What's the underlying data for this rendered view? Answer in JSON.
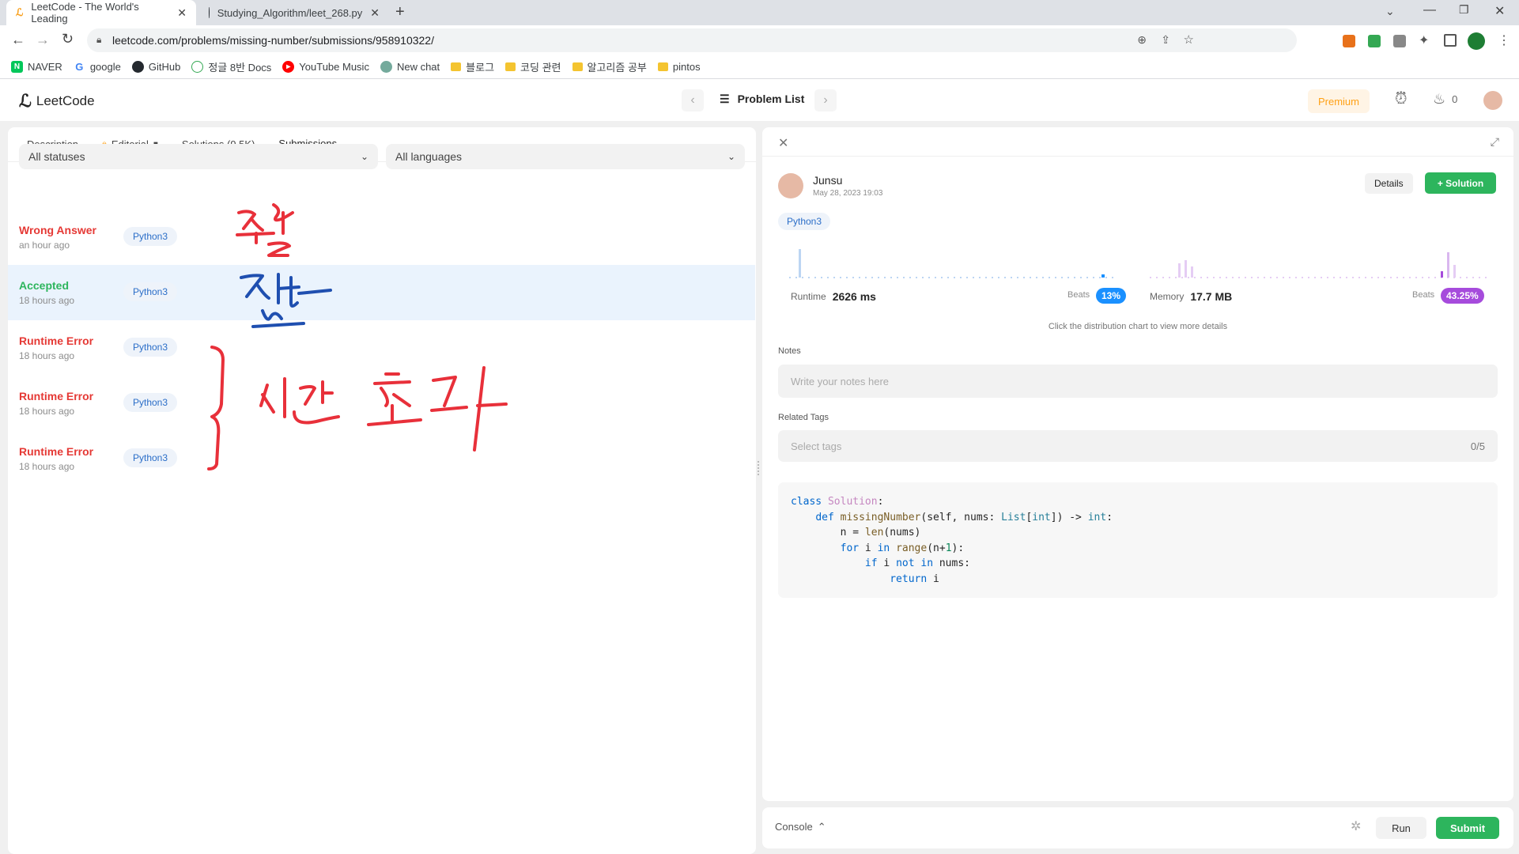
{
  "browser": {
    "tabs": [
      {
        "title": "LeetCode - The World's Leading"
      },
      {
        "title": "Studying_Algorithm/leet_268.py"
      }
    ],
    "new_tab": "+",
    "url": "leetcode.com/problems/missing-number/submissions/958910322/",
    "bookmarks": [
      "NAVER",
      "google",
      "GitHub",
      "정글 8반 Docs",
      "YouTube Music",
      "New chat",
      "블로그",
      "코딩 관련",
      "알고리즘 공부",
      "pintos"
    ]
  },
  "nav": {
    "logo": "LeetCode",
    "problem_list": "Problem List",
    "premium": "Premium",
    "streak": "0"
  },
  "left": {
    "tabs": {
      "description": "Description",
      "editorial": "Editorial",
      "solutions": "Solutions (9.5K)",
      "submissions": "Submissions"
    },
    "filters": {
      "status": "All statuses",
      "language": "All languages"
    },
    "submissions": [
      {
        "status": "Wrong Answer",
        "time": "an hour ago",
        "lang": "Python3"
      },
      {
        "status": "Accepted",
        "time": "18 hours ago",
        "lang": "Python3"
      },
      {
        "status": "Runtime Error",
        "time": "18 hours ago",
        "lang": "Python3"
      },
      {
        "status": "Runtime Error",
        "time": "18 hours ago",
        "lang": "Python3"
      },
      {
        "status": "Runtime Error",
        "time": "18 hours ago",
        "lang": "Python3"
      }
    ]
  },
  "right": {
    "user": "Junsu",
    "date": "May 28, 2023 19:03",
    "details": "Details",
    "solution": "+ Solution",
    "lang": "Python3",
    "runtime_label": "Runtime",
    "runtime_value": "2626 ms",
    "runtime_beats_label": "Beats",
    "runtime_beats": "13%",
    "memory_label": "Memory",
    "memory_value": "17.7 MB",
    "memory_beats_label": "Beats",
    "memory_beats": "43.25%",
    "chart_hint": "Click the distribution chart to view more details",
    "notes_label": "Notes",
    "notes_placeholder": "Write your notes here",
    "tags_label": "Related Tags",
    "tags_placeholder": "Select tags",
    "tags_count": "0/5"
  },
  "footer": {
    "console": "Console",
    "run": "Run",
    "submit": "Submit"
  },
  "colors": {
    "accent_green": "#2db55d",
    "error_red": "#e53935",
    "beats_blue": "#1a90ff",
    "beats_purple": "#a64bdc"
  }
}
